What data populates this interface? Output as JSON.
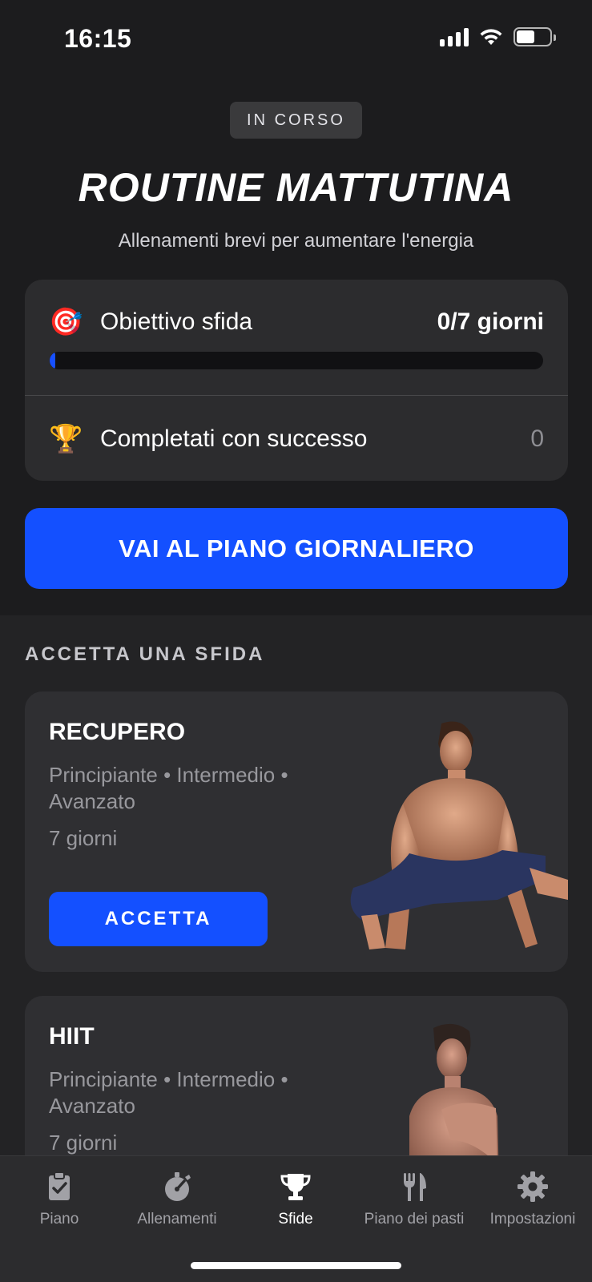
{
  "status_bar": {
    "time": "16:15"
  },
  "hero": {
    "badge": "IN CORSO",
    "title": "ROUTINE MATTUTINA",
    "subtitle": "Allenamenti brevi per aumentare l'energia"
  },
  "goal_card": {
    "goal_icon": "target-dart-icon",
    "goal_label": "Obiettivo sfida",
    "goal_value": "0/7 giorni",
    "progress_fraction": 0.0,
    "completed_icon": "trophy-icon",
    "completed_label": "Completati con successo",
    "completed_value": "0"
  },
  "cta": {
    "label": "VAI AL PIANO GIORNALIERO"
  },
  "challenges": {
    "heading": "ACCETTA UNA SFIDA",
    "items": [
      {
        "name": "RECUPERO",
        "levels": "Principiante • Intermedio • Avanzato",
        "duration": "7 giorni",
        "accept_label": "ACCETTA"
      },
      {
        "name": "HIIT",
        "levels": "Principiante • Intermedio • Avanzato",
        "duration": "7 giorni"
      }
    ]
  },
  "tabbar": {
    "tabs": [
      {
        "label": "Piano",
        "icon": "clipboard-check-icon",
        "active": false
      },
      {
        "label": "Allenamenti",
        "icon": "stopwatch-icon",
        "active": false
      },
      {
        "label": "Sfide",
        "icon": "trophy-icon",
        "active": true
      },
      {
        "label": "Piano dei pasti",
        "icon": "fork-knife-icon",
        "active": false
      },
      {
        "label": "Impostazioni",
        "icon": "gear-icon",
        "active": false
      }
    ]
  },
  "colors": {
    "accent": "#1450ff",
    "background": "#1c1c1e",
    "card": "#2c2c2e"
  }
}
